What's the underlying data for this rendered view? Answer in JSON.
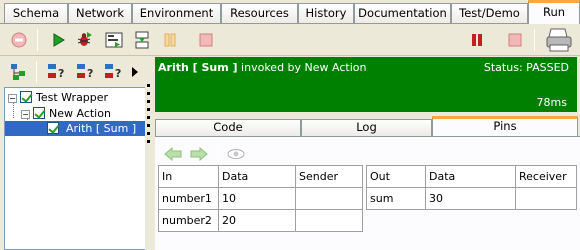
{
  "tabs": [
    {
      "label": "Schema"
    },
    {
      "label": "Network"
    },
    {
      "label": "Environment"
    },
    {
      "label": "Resources"
    },
    {
      "label": "History"
    },
    {
      "label": "Documentation"
    },
    {
      "label": "Test/Demo"
    },
    {
      "label": "Run",
      "active": true
    }
  ],
  "toolbar": {
    "icons": [
      "stop-disabled-icon",
      "run-icon",
      "debug-icon",
      "step-into-icon",
      "step-over-icon",
      "pause-disabled-icon",
      "stop-disabled-icon",
      "pause-icon",
      "stop-icon",
      "print-icon"
    ]
  },
  "tree": {
    "root": {
      "label": "Test Wrapper"
    },
    "child": {
      "label": "New Action"
    },
    "leaf": {
      "label": "Arith [ Sum ]"
    }
  },
  "status": {
    "name": "Arith [ Sum ]",
    "suffix": " invoked by New Action",
    "state": "Status: PASSED",
    "time": "78ms",
    "color": "#008000"
  },
  "inner_tabs": [
    {
      "label": "Code"
    },
    {
      "label": "Log"
    },
    {
      "label": "Pins",
      "active": true
    }
  ],
  "inputs_table": {
    "headers": [
      "In",
      "Data",
      "Sender"
    ],
    "rows": [
      [
        "number1",
        "10",
        ""
      ],
      [
        "number2",
        "20",
        ""
      ]
    ]
  },
  "outputs_table": {
    "headers": [
      "Out",
      "Data",
      "Receiver"
    ],
    "rows": [
      [
        "sum",
        "30",
        ""
      ]
    ]
  }
}
